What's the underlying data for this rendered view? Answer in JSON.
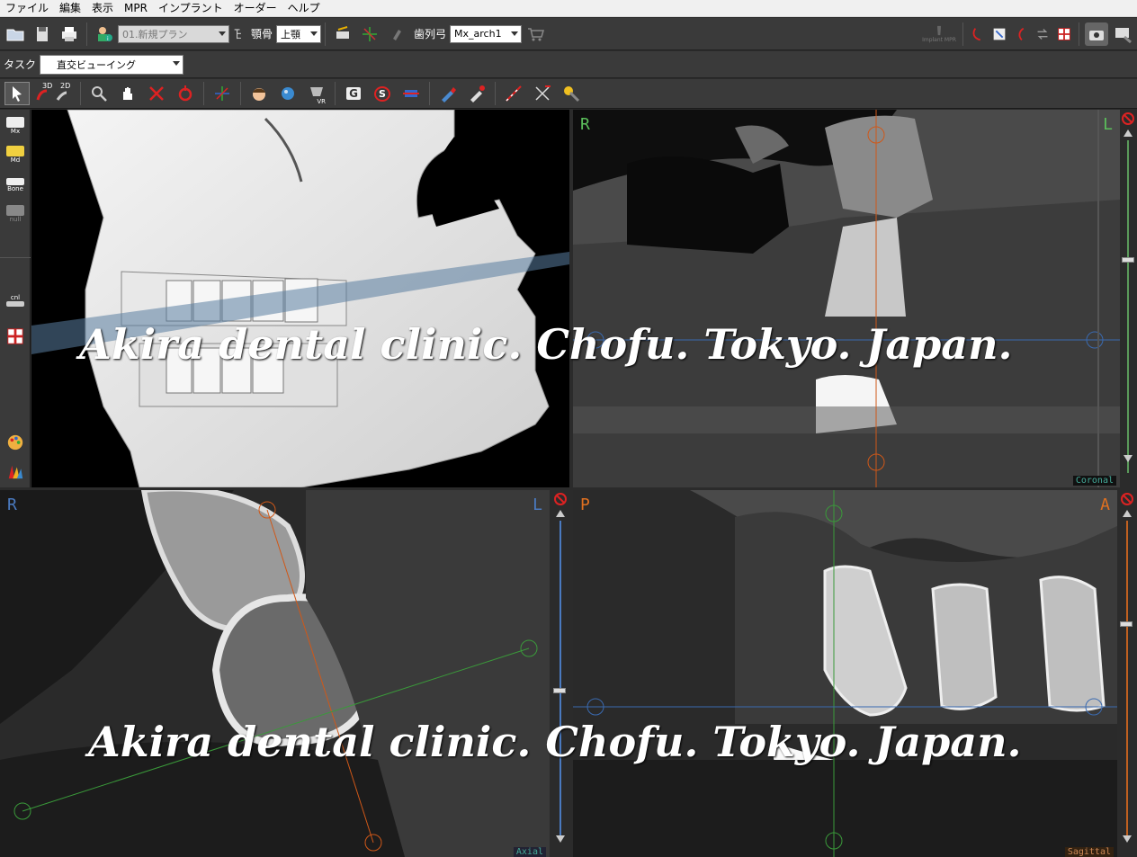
{
  "menu": [
    "ファイル",
    "編集",
    "表示",
    "MPR",
    "インプラント",
    "オーダー",
    "ヘルプ"
  ],
  "toolbar": {
    "plan_value": "01.新規プラン",
    "jaw_label": "顎骨",
    "jaw_value": "上顎",
    "arch_label": "歯列弓",
    "arch_value": "Mx_arch1",
    "implant_mpr_label": "Implant MPR"
  },
  "task": {
    "label": "タスク",
    "value": "直交ビューイング"
  },
  "tools3": {
    "btn_3d": "3D",
    "btn_2d": "2D",
    "btn_vr": "VR",
    "btn_g": "G",
    "btn_s": "S"
  },
  "sidebar": {
    "mx": "Mx",
    "md": "Md",
    "bone": "Bone",
    "null": "null",
    "cnl": "cnl"
  },
  "viewports": {
    "coronal": {
      "left": "R",
      "right": "L",
      "name": "Coronal"
    },
    "axial": {
      "left": "R",
      "right": "L",
      "name": "Axial"
    },
    "sagittal": {
      "left": "P",
      "right": "A",
      "name": "Sagittal"
    }
  },
  "watermark": "Akira dental clinic. Chofu. Tokyo. Japan.",
  "colors": {
    "orient_green": "#5bbf5b",
    "orient_orange": "#e07020",
    "orient_blue": "#4a7ac0",
    "crosshair_orange": "#d05818",
    "crosshair_green": "#3a9a3a",
    "crosshair_blue": "#3a6ab0"
  }
}
